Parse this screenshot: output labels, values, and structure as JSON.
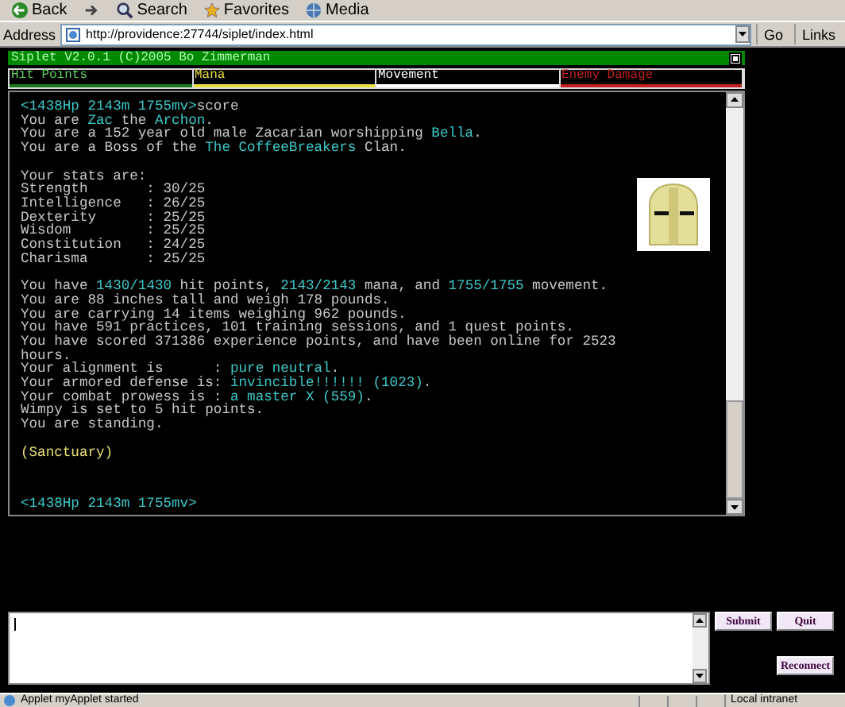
{
  "toolbar": {
    "buttons": [
      {
        "label": "Back",
        "kind": "back"
      },
      {
        "kind": "forward"
      },
      {
        "label": "Search",
        "kind": "search"
      },
      {
        "label": "Favorites",
        "kind": "favorites"
      },
      {
        "label": "Media",
        "kind": "media"
      }
    ]
  },
  "address_bar": {
    "label": "Address",
    "url": "http://providence:27744/siplet/index.html",
    "go": "Go",
    "links": "Links"
  },
  "applet": {
    "title": "Siplet V2.0.1 (C)2005 Bo Zimmerman",
    "meters": [
      {
        "label": "Hit Points",
        "color": "#1a7a1a"
      },
      {
        "label": "Mana",
        "color": "#e8e040"
      },
      {
        "label": "Movement",
        "color": "#ffffff"
      },
      {
        "label": "Enemy Damage",
        "color": "#c02020"
      }
    ],
    "terminal": {
      "blocks": [
        [
          [
            {
              "text": "<1438Hp 2143m 1755mv>",
              "kind": "hl"
            },
            {
              "text": "score",
              "kind": "plain"
            }
          ],
          [
            {
              "text": "You are ",
              "kind": "plain"
            },
            {
              "text": "Zac",
              "kind": "hl"
            },
            {
              "text": " the ",
              "kind": "plain"
            },
            {
              "text": "Archon",
              "kind": "hl"
            },
            {
              "text": ".",
              "kind": "plain"
            }
          ],
          [
            {
              "text": "You are a 152 year old male Zacarian worshipping ",
              "kind": "plain"
            },
            {
              "text": "Bella",
              "kind": "hl"
            },
            {
              "text": ".",
              "kind": "plain"
            }
          ],
          [
            {
              "text": "You are a Boss of the ",
              "kind": "plain"
            },
            {
              "text": "The CoffeeBreakers",
              "kind": "hl"
            },
            {
              "text": " Clan.",
              "kind": "plain"
            }
          ]
        ],
        [
          [
            {
              "text": "Your stats are:",
              "kind": "plain"
            }
          ],
          [
            {
              "text": "Strength       : 30/25",
              "kind": "plain"
            }
          ],
          [
            {
              "text": "Intelligence   : 26/25",
              "kind": "plain"
            }
          ],
          [
            {
              "text": "Dexterity      : 25/25",
              "kind": "plain"
            }
          ],
          [
            {
              "text": "Wisdom         : 25/25",
              "kind": "plain"
            }
          ],
          [
            {
              "text": "Constitution   : 24/25",
              "kind": "plain"
            }
          ],
          [
            {
              "text": "Charisma       : 25/25",
              "kind": "plain"
            }
          ]
        ],
        [
          [
            {
              "text": "You have ",
              "kind": "plain"
            },
            {
              "text": "1430/1430",
              "kind": "hl"
            },
            {
              "text": " hit points, ",
              "kind": "plain"
            },
            {
              "text": "2143/2143",
              "kind": "hl"
            },
            {
              "text": " mana, and ",
              "kind": "plain"
            },
            {
              "text": "1755/1755",
              "kind": "hl"
            },
            {
              "text": " movement.",
              "kind": "plain"
            }
          ],
          [
            {
              "text": "You are 88 inches tall and weigh 178 pounds.",
              "kind": "plain"
            }
          ],
          [
            {
              "text": "You are carrying 14 items weighing 962 pounds.",
              "kind": "plain"
            }
          ],
          [
            {
              "text": "You have 591 practices, 101 training sessions, and 1 quest points.",
              "kind": "plain"
            }
          ],
          [
            {
              "text": "You have scored 371386 experience points, and have been online for 2523",
              "kind": "plain"
            }
          ],
          [
            {
              "text": "hours.",
              "kind": "plain"
            }
          ],
          [
            {
              "text": "Your alignment is      : ",
              "kind": "plain"
            },
            {
              "text": "pure neutral",
              "kind": "hl"
            },
            {
              "text": ".",
              "kind": "plain"
            }
          ],
          [
            {
              "text": "Your armored defense is: ",
              "kind": "plain"
            },
            {
              "text": "invincible!!!!!! (1023)",
              "kind": "hl"
            },
            {
              "text": ".",
              "kind": "plain"
            }
          ],
          [
            {
              "text": "Your combat prowess is : ",
              "kind": "plain"
            },
            {
              "text": "a master X (559)",
              "kind": "hl"
            },
            {
              "text": ".",
              "kind": "plain"
            }
          ],
          [
            {
              "text": "Wimpy is set to 5 hit points.",
              "kind": "plain"
            }
          ],
          [
            {
              "text": "You are standing.",
              "kind": "plain"
            }
          ]
        ],
        [
          [
            {
              "text": "(Sanctuary)",
              "kind": "room"
            }
          ]
        ]
      ],
      "prompt": "<1438Hp 2143m 1755mv>"
    },
    "buttons": [
      {
        "label": "Submit",
        "kind": "submit"
      },
      {
        "label": "Quit",
        "kind": "quit"
      },
      {
        "label": "Reconnect",
        "kind": "reconnect"
      }
    ]
  },
  "status_bar": {
    "message": "Applet myApplet started",
    "zone": "Local intranet"
  }
}
